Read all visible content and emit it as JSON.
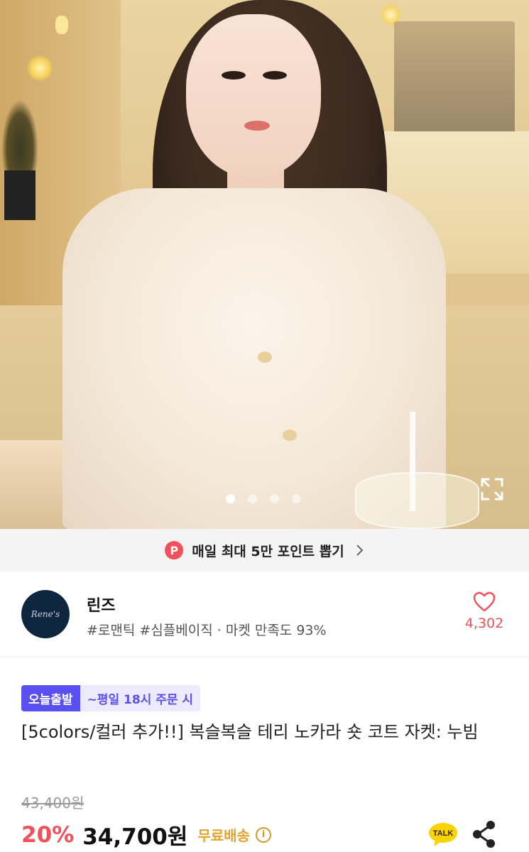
{
  "points_banner": {
    "badge": "P",
    "text": "매일 최대 5만 포인트 뽑기"
  },
  "shop": {
    "logo_text": "Rene's",
    "name": "린즈",
    "tags": "#로맨틱 #심플베이직 · 마켓 만족도 93%",
    "like_count": "4,302"
  },
  "product": {
    "badge_today": "오늘출발",
    "badge_time": "~평일 18시 주문 시",
    "title": "[5colors/컬러 추가!!] 복슬복슬 테리 노카라 숏 코트 자켓: 누빔",
    "original_price": "43,400원",
    "discount": "20%",
    "price": "34,700원",
    "shipping": "무료배송",
    "info_icon": "i"
  },
  "carousel": {
    "total": 4,
    "active": 0
  },
  "icons": [
    "expand-icon",
    "chevron-right-icon",
    "heart-icon",
    "info-icon",
    "kakao-talk-icon",
    "share-icon"
  ],
  "colors": {
    "accent": "#f2505b",
    "badge": "#5a4ff0",
    "shipping": "#e5a32a"
  }
}
